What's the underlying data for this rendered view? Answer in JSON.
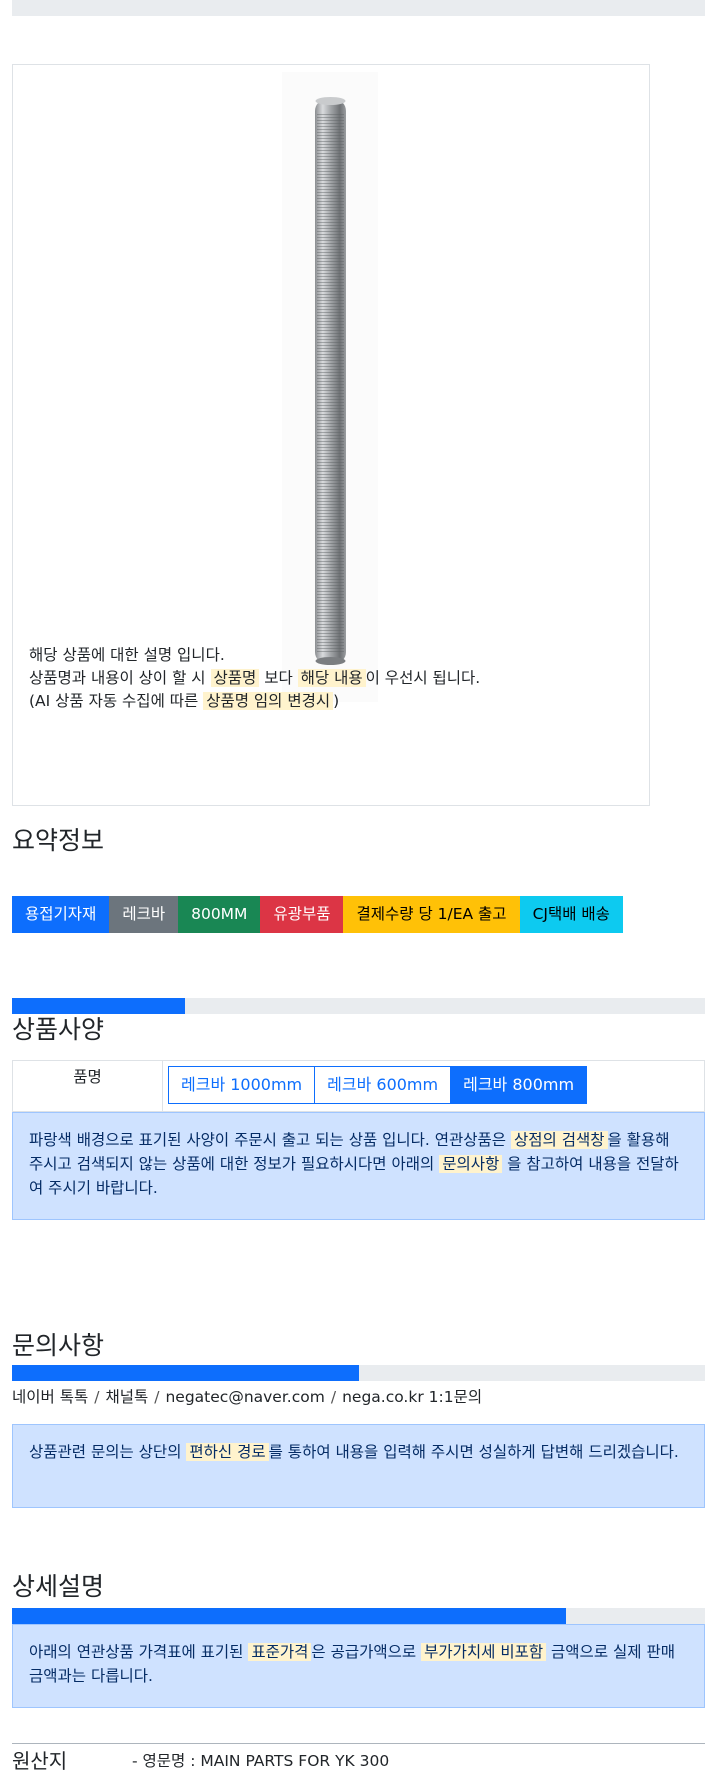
{
  "product": {
    "description_lines": [
      "해당 상품에 대한 설명 입니다.",
      [
        "상품명과 내용이 상이 할 시 ",
        "상품명",
        " 보다 ",
        "해당 내용",
        "이 우선시 됩니다."
      ],
      [
        "(AI 상품 자동 수집에 따른 ",
        "상품명 임의 변경시",
        ")"
      ]
    ]
  },
  "summary": {
    "title": "요약정보",
    "badges": [
      {
        "label": "용접기자재",
        "bg": "#0d6efd",
        "fg": "#ffffff"
      },
      {
        "label": "레크바",
        "bg": "#6c757d",
        "fg": "#ffffff"
      },
      {
        "label": "800MM",
        "bg": "#198754",
        "fg": "#ffffff"
      },
      {
        "label": "유광부품",
        "bg": "#dc3545",
        "fg": "#ffffff"
      },
      {
        "label": "결제수량 당 1/EA 출고",
        "bg": "#ffc107",
        "fg": "#000000"
      },
      {
        "label": "CJ택배 배송",
        "bg": "#0dcaf0",
        "fg": "#000000"
      }
    ]
  },
  "spec": {
    "title": "상품사양",
    "progress": 0.25,
    "label": "품명",
    "options": [
      {
        "label": "레크바 1000mm",
        "active": false
      },
      {
        "label": "레크바 600mm",
        "active": false
      },
      {
        "label": "레크바 800mm",
        "active": true
      }
    ],
    "notice": [
      "파랑색 배경으로 표기된 사양이 주문시 출고 되는 상품 입니다. 연관상품은 ",
      "상점의 검색창",
      "을 활용해 주시고 검색되지 않는 상품에 대한 정보가 필요하시다면 아래의 ",
      "문의사항",
      " 을 참고하여 내용을 전달하여 주시기 바랍니다."
    ]
  },
  "inquiry": {
    "title": "문의사항",
    "progress": 0.5,
    "contacts": [
      "네이버 톡톡",
      "채널톡",
      "negatec@naver.com",
      "nega.co.kr 1:1문의"
    ],
    "notice": [
      "상품관련 문의는 상단의 ",
      "편하신 경로",
      "를 통하여 내용을 입력해 주시면 성실하게 답변해 드리겠습니다."
    ]
  },
  "detail": {
    "title": "상세설명",
    "progress": 0.8,
    "notice": [
      "아래의 연관상품 가격표에 표기된 ",
      "표준가격",
      "은 공급가액으로 ",
      "부가가치세 비포함",
      " 금액으로 실제 판매금액과는 다릅니다."
    ]
  },
  "origin": {
    "label": "원산지",
    "value": "- 영문명 : MAIN PARTS FOR YK 300"
  }
}
